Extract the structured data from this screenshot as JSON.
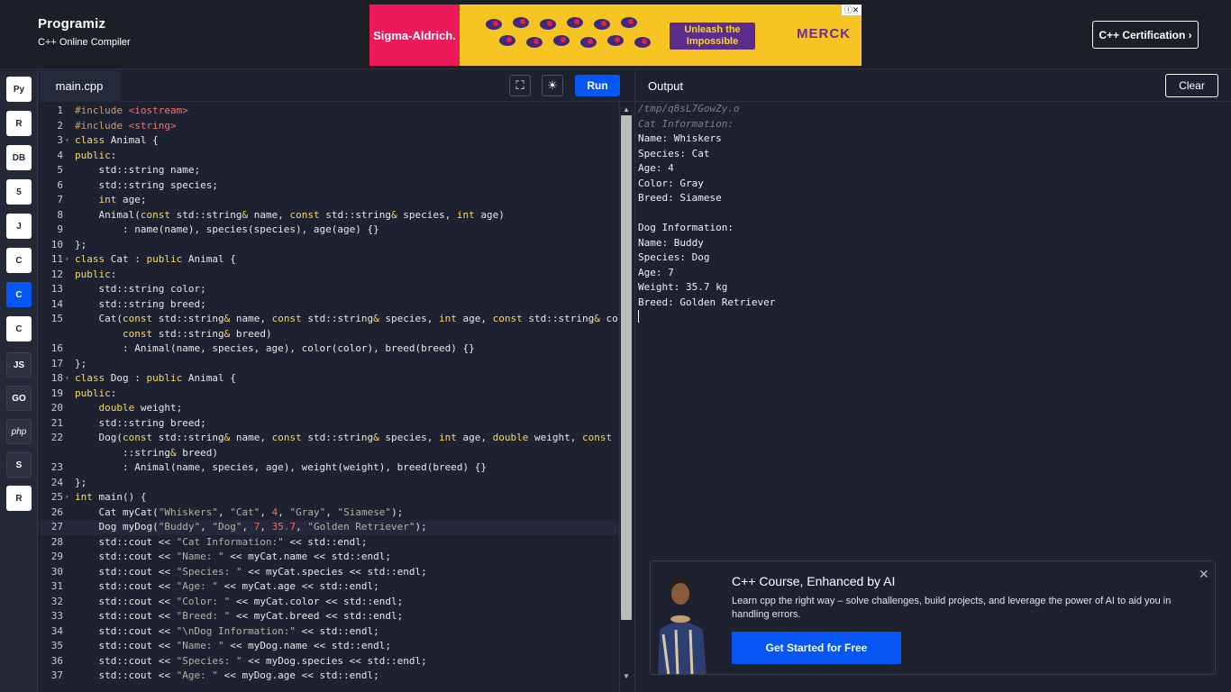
{
  "header": {
    "logo_name": "Programiz",
    "logo_sub": "C++ Online Compiler",
    "ad": {
      "left_text": "Sigma-Aldrich.",
      "cta": "Unleash the Impossible",
      "brand": "MERCK",
      "close": "ⓘ✕"
    },
    "certification_label": "C++ Certification ›"
  },
  "sidebar": {
    "items": [
      {
        "icon": "python-icon",
        "label": "Py"
      },
      {
        "icon": "r-icon",
        "label": "R"
      },
      {
        "icon": "database-icon",
        "label": "DB"
      },
      {
        "icon": "html5-icon",
        "label": "5"
      },
      {
        "icon": "java-icon",
        "label": "J"
      },
      {
        "icon": "c-icon",
        "label": "C"
      },
      {
        "icon": "cpp-icon",
        "label": "C"
      },
      {
        "icon": "csharp-icon",
        "label": "C"
      },
      {
        "icon": "js-icon",
        "label": "JS"
      },
      {
        "icon": "go-icon",
        "label": "GO"
      },
      {
        "icon": "php-icon",
        "label": "php"
      },
      {
        "icon": "swift-icon",
        "label": "S"
      },
      {
        "icon": "rust-icon",
        "label": "R"
      }
    ]
  },
  "editor": {
    "tab_label": "main.cpp",
    "fullscreen_icon": "⛶",
    "theme_icon": "☀",
    "run_label": "Run"
  },
  "output": {
    "title": "Output",
    "clear_label": "Clear",
    "lines": [
      {
        "text": "/tmp/q8sL7GowZy.o",
        "dim": true
      },
      {
        "text": "Cat Information:",
        "dim": true
      },
      {
        "text": "Name: Whiskers",
        "dim": false
      },
      {
        "text": "Species: Cat",
        "dim": false
      },
      {
        "text": "Age: 4",
        "dim": false
      },
      {
        "text": "Color: Gray",
        "dim": false
      },
      {
        "text": "Breed: Siamese",
        "dim": false
      },
      {
        "text": "",
        "dim": false
      },
      {
        "text": "Dog Information:",
        "dim": false
      },
      {
        "text": "Name: Buddy",
        "dim": false
      },
      {
        "text": "Species: Dog",
        "dim": false
      },
      {
        "text": "Age: 7",
        "dim": false
      },
      {
        "text": "Weight: 35.7 kg",
        "dim": false
      },
      {
        "text": "Breed: Golden Retriever",
        "dim": false
      }
    ]
  },
  "promo": {
    "title": "C++ Course, Enhanced by AI",
    "desc": "Learn cpp the right way – solve challenges, build projects, and leverage the power of AI to aid you in handling errors.",
    "button": "Get Started for Free",
    "close": "✕"
  },
  "colors": {
    "accent": "#0556f3",
    "background": "#1d2130",
    "keyword": "#f8d864",
    "string": "#a9b8a0",
    "include": "#f07470"
  },
  "code": [
    {
      "n": "1",
      "f": "",
      "h": "<span class=\"pp\">#include</span> <span class=\"inc\">&lt;iostream&gt;</span>"
    },
    {
      "n": "2",
      "f": "",
      "h": "<span class=\"pp\">#include</span> <span class=\"inc\">&lt;string&gt;</span>"
    },
    {
      "n": "3",
      "f": "▾",
      "h": "<span class=\"k\">class</span> Animal {"
    },
    {
      "n": "4",
      "f": "",
      "h": "<span class=\"k\">public</span>:"
    },
    {
      "n": "5",
      "f": "",
      "h": "    std::string name;"
    },
    {
      "n": "6",
      "f": "",
      "h": "    std::string species;"
    },
    {
      "n": "7",
      "f": "",
      "h": "    <span class=\"k\">int</span> age;"
    },
    {
      "n": "8",
      "f": "",
      "h": "    Animal(<span class=\"k\">const</span> std::string<span class=\"k\">&amp;</span> name, <span class=\"k\">const</span> std::string<span class=\"k\">&amp;</span> species, <span class=\"k\">int</span> age)"
    },
    {
      "n": "9",
      "f": "",
      "h": "        : name(name), species(species), age(age) {}"
    },
    {
      "n": "10",
      "f": "",
      "h": "};"
    },
    {
      "n": "11",
      "f": "▾",
      "h": "<span class=\"k\">class</span> Cat : <span class=\"k\">public</span> Animal {"
    },
    {
      "n": "12",
      "f": "",
      "h": "<span class=\"k\">public</span>:"
    },
    {
      "n": "13",
      "f": "",
      "h": "    std::string color;"
    },
    {
      "n": "14",
      "f": "",
      "h": "    std::string breed;"
    },
    {
      "n": "15",
      "f": "",
      "h": "    Cat(<span class=\"k\">const</span> std::string<span class=\"k\">&amp;</span> name, <span class=\"k\">const</span> std::string<span class=\"k\">&amp;</span> species, <span class=\"k\">int</span> age, <span class=\"k\">const</span> std::string<span class=\"k\">&amp;</span> color,"
    },
    {
      "n": "",
      "f": "",
      "h": "        <span class=\"k\">const</span> std::string<span class=\"k\">&amp;</span> breed)"
    },
    {
      "n": "16",
      "f": "",
      "h": "        : Animal(name, species, age), color(color), breed(breed) {}"
    },
    {
      "n": "17",
      "f": "",
      "h": "};"
    },
    {
      "n": "18",
      "f": "▾",
      "h": "<span class=\"k\">class</span> Dog : <span class=\"k\">public</span> Animal {"
    },
    {
      "n": "19",
      "f": "",
      "h": "<span class=\"k\">public</span>:"
    },
    {
      "n": "20",
      "f": "",
      "h": "    <span class=\"k\">double</span> weight;"
    },
    {
      "n": "21",
      "f": "",
      "h": "    std::string breed;"
    },
    {
      "n": "22",
      "f": "",
      "h": "    Dog(<span class=\"k\">const</span> std::string<span class=\"k\">&amp;</span> name, <span class=\"k\">const</span> std::string<span class=\"k\">&amp;</span> species, <span class=\"k\">int</span> age, <span class=\"k\">double</span> weight, <span class=\"k\">const</span> std"
    },
    {
      "n": "",
      "f": "",
      "h": "        ::string<span class=\"k\">&amp;</span> breed)"
    },
    {
      "n": "23",
      "f": "",
      "h": "        : Animal(name, species, age), weight(weight), breed(breed) {}"
    },
    {
      "n": "24",
      "f": "",
      "h": "};"
    },
    {
      "n": "25",
      "f": "▾",
      "h": "<span class=\"k\">int</span> main() {"
    },
    {
      "n": "26",
      "f": "",
      "h": "    Cat myCat(<span class=\"s\">\"Whiskers\"</span>, <span class=\"s\">\"Cat\"</span>, <span class=\"n\">4</span>, <span class=\"s\">\"Gray\"</span>, <span class=\"s\">\"Siamese\"</span>);"
    },
    {
      "n": "27",
      "f": "",
      "h": "    Dog myDog(<span class=\"s\">\"Buddy\"</span>, <span class=\"s\">\"Dog\"</span>, <span class=\"n\">7</span>, <span class=\"n\">35.7</span>, <span class=\"s\">\"Golden Retriever\"</span>);",
      "hl": true
    },
    {
      "n": "28",
      "f": "",
      "h": "    std::cout &lt;&lt; <span class=\"s\">\"Cat Information:\"</span> &lt;&lt; std::endl;"
    },
    {
      "n": "29",
      "f": "",
      "h": "    std::cout &lt;&lt; <span class=\"s\">\"Name: \"</span> &lt;&lt; myCat.name &lt;&lt; std::endl;"
    },
    {
      "n": "30",
      "f": "",
      "h": "    std::cout &lt;&lt; <span class=\"s\">\"Species: \"</span> &lt;&lt; myCat.species &lt;&lt; std::endl;"
    },
    {
      "n": "31",
      "f": "",
      "h": "    std::cout &lt;&lt; <span class=\"s\">\"Age: \"</span> &lt;&lt; myCat.age &lt;&lt; std::endl;"
    },
    {
      "n": "32",
      "f": "",
      "h": "    std::cout &lt;&lt; <span class=\"s\">\"Color: \"</span> &lt;&lt; myCat.color &lt;&lt; std::endl;"
    },
    {
      "n": "33",
      "f": "",
      "h": "    std::cout &lt;&lt; <span class=\"s\">\"Breed: \"</span> &lt;&lt; myCat.breed &lt;&lt; std::endl;"
    },
    {
      "n": "34",
      "f": "",
      "h": "    std::cout &lt;&lt; <span class=\"s\">\"\\nDog Information:\"</span> &lt;&lt; std::endl;"
    },
    {
      "n": "35",
      "f": "",
      "h": "    std::cout &lt;&lt; <span class=\"s\">\"Name: \"</span> &lt;&lt; myDog.name &lt;&lt; std::endl;"
    },
    {
      "n": "36",
      "f": "",
      "h": "    std::cout &lt;&lt; <span class=\"s\">\"Species: \"</span> &lt;&lt; myDog.species &lt;&lt; std::endl;"
    },
    {
      "n": "37",
      "f": "",
      "h": "    std::cout &lt;&lt; <span class=\"s\">\"Age: \"</span> &lt;&lt; myDog.age &lt;&lt; std::endl;"
    }
  ]
}
